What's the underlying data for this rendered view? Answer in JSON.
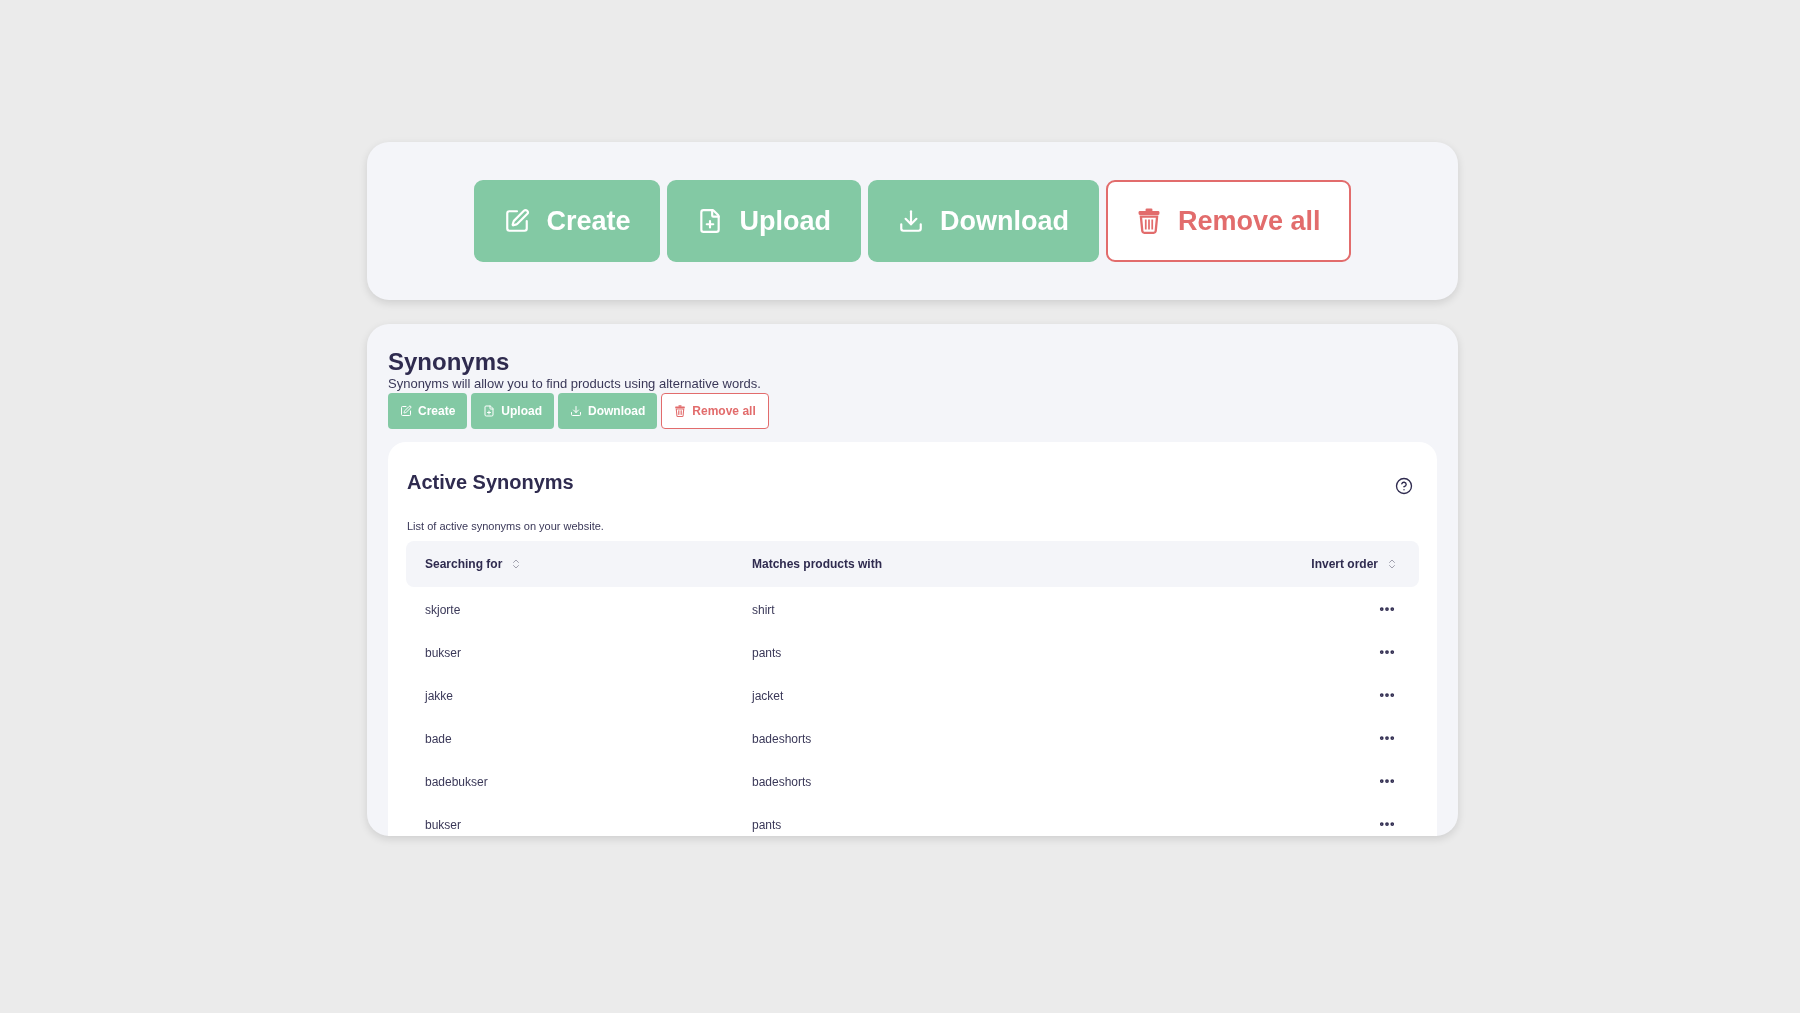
{
  "top_toolbar": {
    "buttons": [
      {
        "label": "Create",
        "kind": "primary"
      },
      {
        "label": "Upload",
        "kind": "primary"
      },
      {
        "label": "Download",
        "kind": "primary"
      },
      {
        "label": "Remove all",
        "kind": "danger"
      }
    ]
  },
  "synonyms_panel": {
    "title": "Synonyms",
    "description": "Synonyms will allow you to find products using alternative words.",
    "buttons": [
      {
        "label": "Create",
        "kind": "primary"
      },
      {
        "label": "Upload",
        "kind": "primary"
      },
      {
        "label": "Download",
        "kind": "primary"
      },
      {
        "label": "Remove all",
        "kind": "danger"
      }
    ],
    "active_synonyms": {
      "title": "Active Synonyms",
      "description": "List of active synonyms on your website.",
      "table": {
        "columns": [
          {
            "label": "Searching for",
            "sortable": true
          },
          {
            "label": "Matches products with",
            "sortable": false
          },
          {
            "label": "Invert order",
            "sortable": true
          }
        ],
        "rows": [
          {
            "searching_for": "skjorte",
            "matches_products_with": "shirt"
          },
          {
            "searching_for": "bukser",
            "matches_products_with": "pants"
          },
          {
            "searching_for": "jakke",
            "matches_products_with": "jacket"
          },
          {
            "searching_for": "bade",
            "matches_products_with": "badeshorts"
          },
          {
            "searching_for": "badebukser",
            "matches_products_with": "badeshorts"
          },
          {
            "searching_for": "bukser",
            "matches_products_with": "pants"
          }
        ]
      }
    }
  }
}
